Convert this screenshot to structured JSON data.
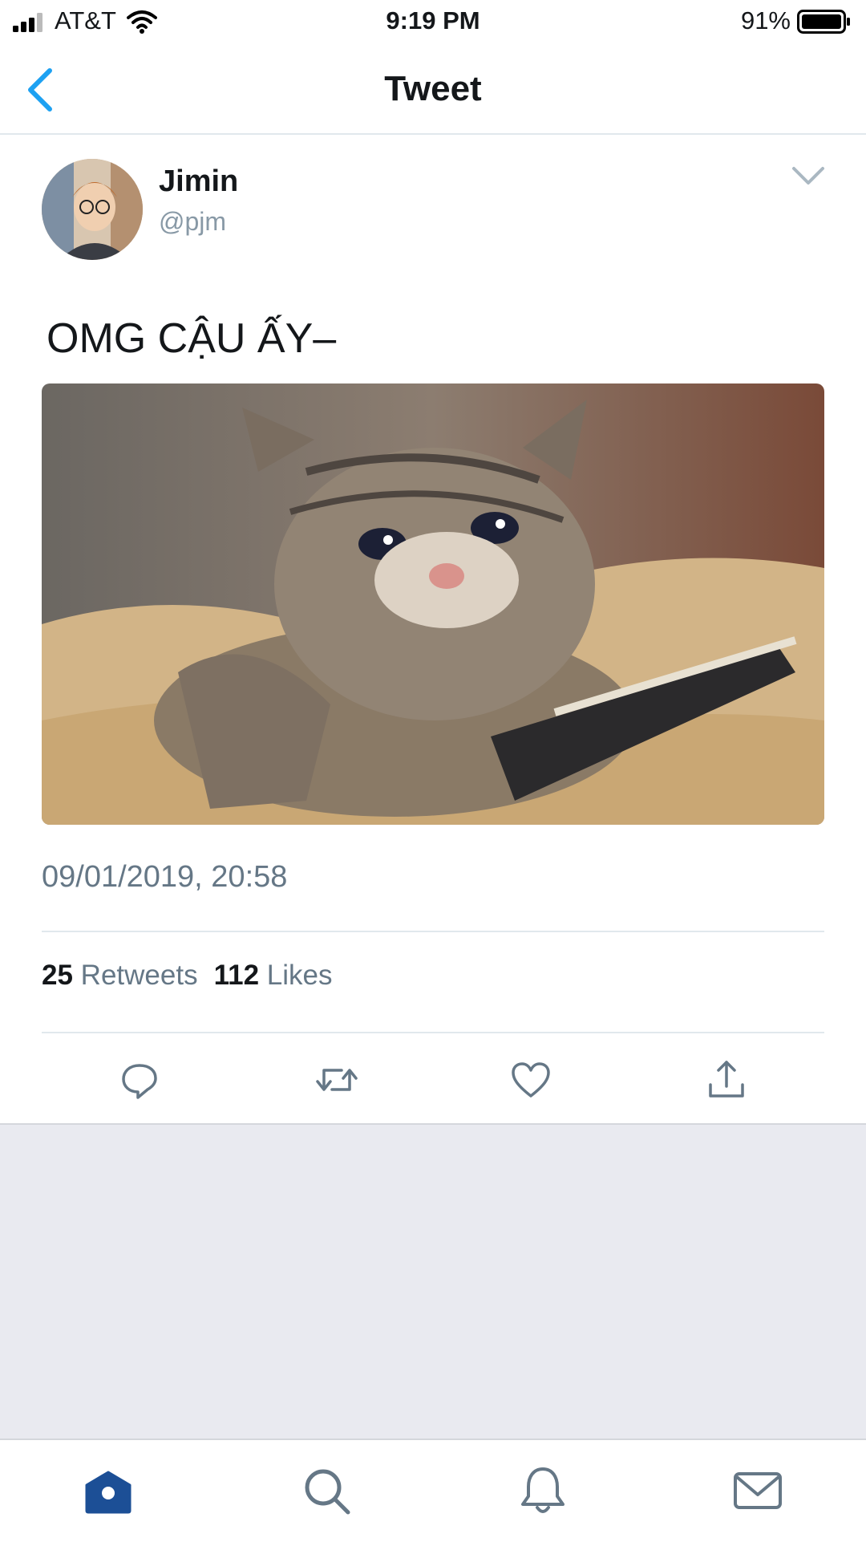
{
  "status_bar": {
    "carrier": "AT&T",
    "time": "9:19 PM",
    "battery": "91%",
    "battery_level": 0.91
  },
  "nav": {
    "title": "Tweet",
    "back_icon": "back-chevron-icon"
  },
  "tweet": {
    "display_name": "Jimin",
    "handle": "@pjm",
    "text": "OMG CẬU ẤY–",
    "timestamp": "09/01/2019, 20:58",
    "retweet_count": "25",
    "retweet_label": "Retweets",
    "like_count": "112",
    "like_label": "Likes"
  },
  "actions": [
    "reply-icon",
    "retweet-icon",
    "like-icon",
    "share-icon"
  ],
  "tabbar": [
    "home-icon",
    "search-icon",
    "notifications-icon",
    "messages-icon"
  ],
  "colors": {
    "accent": "#1da1f2",
    "tab_active": "#1c4f96",
    "icon_gray": "#657786",
    "divider": "#e1e8ed",
    "empty_area": "#e9eaf0"
  }
}
